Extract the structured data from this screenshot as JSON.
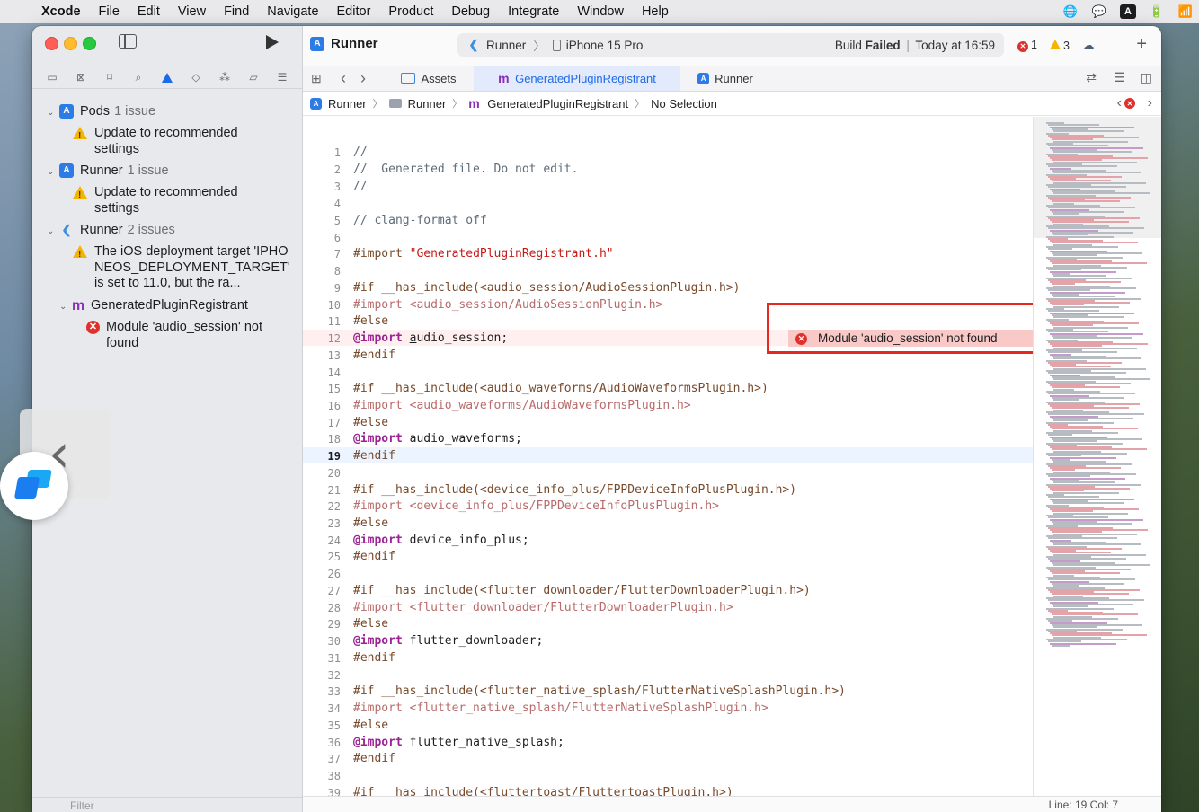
{
  "menubar": {
    "app": "Xcode",
    "items": [
      "File",
      "Edit",
      "View",
      "Find",
      "Navigate",
      "Editor",
      "Product",
      "Debug",
      "Integrate",
      "Window",
      "Help"
    ],
    "right_icons": [
      "globe-icon",
      "wechat-icon",
      "input-source-icon",
      "battery-icon",
      "wifi-icon"
    ],
    "input_source": "A"
  },
  "toolbar": {
    "project": "Runner",
    "scheme": "Runner",
    "device": "iPhone 15 Pro",
    "build_label": "Build",
    "build_result": "Failed",
    "build_time": "Today at 16:59",
    "error_count": "1",
    "warning_count": "3"
  },
  "navigator": {
    "tree": [
      {
        "label": "Pods",
        "count": "1 issue"
      },
      {
        "label": "Update to recommended settings"
      },
      {
        "label": "Runner",
        "count": "1 issue"
      },
      {
        "label": "Update to recommended settings"
      },
      {
        "label": "Runner",
        "count": "2 issues"
      },
      {
        "label": "The iOS deployment target 'IPHONEOS_DEPLOYMENT_TARGET' is set to 11.0, but the ra..."
      },
      {
        "label": "GeneratedPluginRegistrant"
      },
      {
        "label": "Module 'audio_session' not found"
      }
    ],
    "filter_placeholder": "Filter"
  },
  "tabs": [
    {
      "label": "Assets"
    },
    {
      "label": "GeneratedPluginRegistrant"
    },
    {
      "label": "Runner"
    }
  ],
  "jumpbar": {
    "items": [
      "Runner",
      "Runner",
      "GeneratedPluginRegistrant",
      "No Selection"
    ]
  },
  "editor": {
    "error_message": "Module 'audio_session' not found",
    "error_line": 12,
    "current_line": 19
  },
  "statusbar": {
    "position": "Line: 19  Col: 7"
  },
  "colors": {
    "accent": "#1c6be8",
    "error": "#e0302b",
    "warning": "#f5b400",
    "highlight_box": "#e8281f"
  }
}
